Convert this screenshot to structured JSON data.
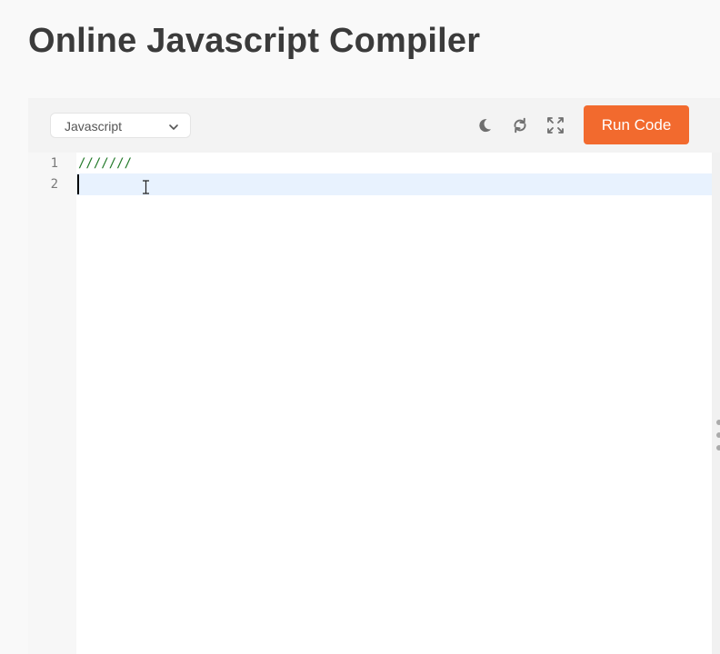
{
  "page": {
    "title": "Online Javascript Compiler"
  },
  "toolbar": {
    "language_selected": "Javascript",
    "run_label": "Run Code",
    "icons": [
      "moon-icon",
      "refresh-icon",
      "fullscreen-icon",
      "chevron-down-icon"
    ]
  },
  "editor": {
    "line_numbers": [
      "1",
      "2"
    ],
    "lines": [
      "///////",
      ""
    ],
    "active_line": 2
  },
  "colors": {
    "accent": "#f26a2e",
    "comment": "#237a2a",
    "title": "#3b3b3b",
    "active_line_highlight": "#e8f2fe",
    "icon": "#6f6f6f"
  }
}
